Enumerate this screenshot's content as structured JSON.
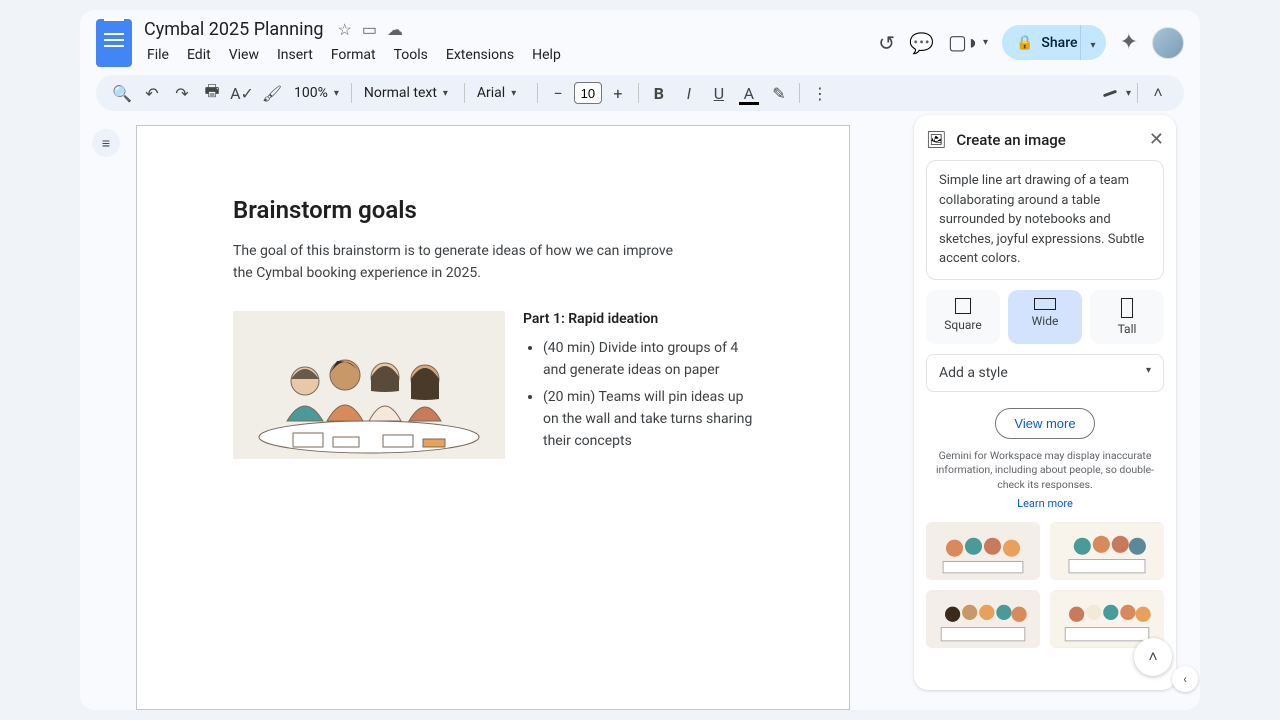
{
  "header": {
    "doc_title": "Cymbal 2025 Planning",
    "menus": [
      "File",
      "Edit",
      "View",
      "Insert",
      "Format",
      "Tools",
      "Extensions",
      "Help"
    ],
    "share_label": "Share"
  },
  "toolbar": {
    "zoom": "100%",
    "style": "Normal text",
    "font": "Arial",
    "font_size": "10"
  },
  "document": {
    "heading": "Brainstorm goals",
    "intro": "The goal of this brainstorm is to generate ideas of how we can improve the Cymbal booking experience in 2025.",
    "part1_title": "Part 1: Rapid ideation",
    "bullets": [
      "(40 min) Divide into groups of 4 and generate ideas on paper",
      "(20 min) Teams will pin ideas up on the wall and take turns sharing their concepts"
    ]
  },
  "side_panel": {
    "title": "Create an image",
    "prompt": "Simple line art drawing of a team collaborating around a table surrounded by notebooks and sketches, joyful expressions. Subtle accent colors.",
    "aspects": {
      "square": "Square",
      "wide": "Wide",
      "tall": "Tall"
    },
    "style_placeholder": "Add a style",
    "view_more": "View more",
    "disclaimer": "Gemini for Workspace may display inaccurate information, including about people, so double-check its responses.",
    "learn_more": "Learn more"
  }
}
